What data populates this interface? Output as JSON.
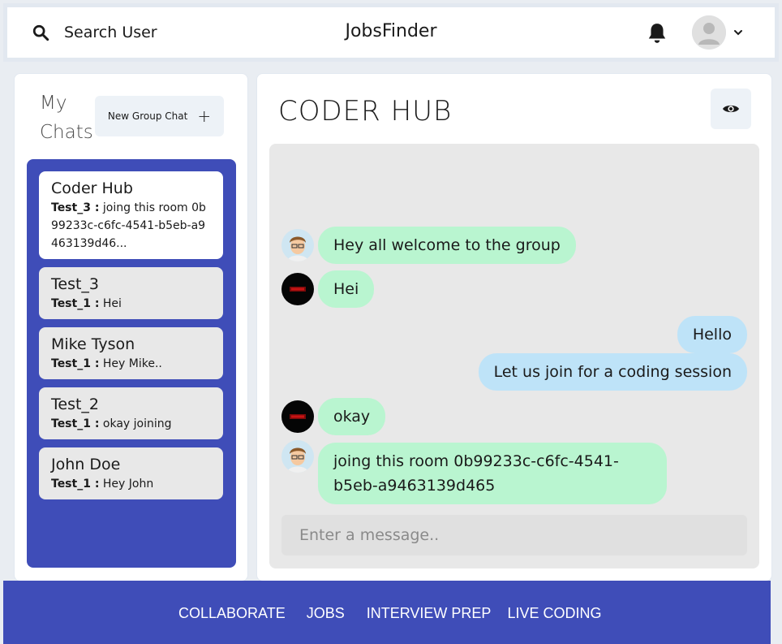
{
  "header": {
    "search_label": "Search User",
    "app_title": "JobsFinder"
  },
  "sidebar": {
    "title_line1": "My",
    "title_line2": "Chats",
    "new_group_label": "New Group Chat",
    "new_group_icon": "+",
    "chats": [
      {
        "name": "Coder Hub",
        "sender": "Test_3 :",
        "preview": " joing this room 0b99233c-c6fc-4541-b5eb-a9463139d46...",
        "active": true
      },
      {
        "name": "Test_3",
        "sender": "Test_1 :",
        "preview": " Hei"
      },
      {
        "name": "Mike Tyson",
        "sender": "Test_1 :",
        "preview": " Hey Mike.."
      },
      {
        "name": "Test_2",
        "sender": "Test_1 :",
        "preview": " okay joining"
      },
      {
        "name": "John Doe",
        "sender": "Test_1 :",
        "preview": " Hey John"
      }
    ]
  },
  "room": {
    "title": "CODER HUB",
    "messages": [
      {
        "text": "Hey all welcome to the group",
        "direction": "in",
        "avatar": "cartoon-boy"
      },
      {
        "text": "Hei",
        "direction": "in",
        "avatar": "dark-logo"
      },
      {
        "text": "Hello",
        "direction": "out"
      },
      {
        "text": "Let us join for a coding session",
        "direction": "out"
      },
      {
        "text": "okay",
        "direction": "in",
        "avatar": "dark-logo"
      },
      {
        "text": "joing this room 0b99233c-c6fc-4541-b5eb-a9463139d465",
        "direction": "in",
        "avatar": "cartoon-boy"
      }
    ],
    "input_placeholder": "Enter a message.."
  },
  "footer": {
    "links": [
      "COLLABORATE",
      "JOBS",
      "INTERVIEW PREP",
      "LIVE CODING"
    ]
  },
  "colors": {
    "accent": "#3f4db8",
    "incoming_bubble": "#b9f5d0",
    "outgoing_bubble": "#bee3f8"
  }
}
